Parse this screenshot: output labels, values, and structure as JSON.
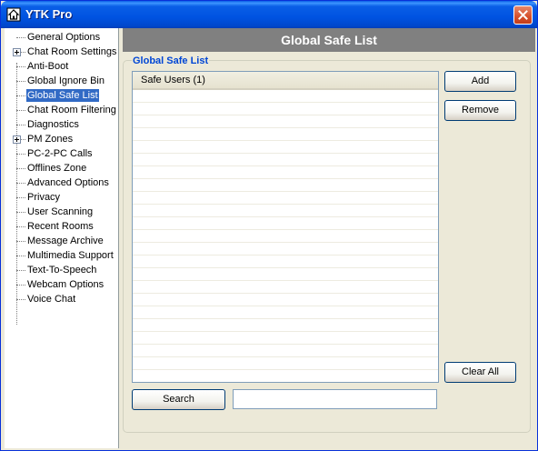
{
  "window": {
    "title": "YTK Pro",
    "app_icon": "home-icon",
    "close_icon": "close-icon",
    "title_color": "#0A5FE6"
  },
  "sidebar": {
    "items": [
      {
        "label": "General Options",
        "expandable": false
      },
      {
        "label": "Chat Room Settings",
        "expandable": true
      },
      {
        "label": "Anti-Boot",
        "expandable": false
      },
      {
        "label": "Global Ignore Bin",
        "expandable": false
      },
      {
        "label": "Global Safe List",
        "expandable": false,
        "selected": true
      },
      {
        "label": "Chat Room Filtering",
        "expandable": false
      },
      {
        "label": "Diagnostics",
        "expandable": false
      },
      {
        "label": "PM Zones",
        "expandable": true
      },
      {
        "label": "PC-2-PC Calls",
        "expandable": false
      },
      {
        "label": "Offlines Zone",
        "expandable": false
      },
      {
        "label": "Advanced Options",
        "expandable": false
      },
      {
        "label": "Privacy",
        "expandable": false
      },
      {
        "label": "User Scanning",
        "expandable": false
      },
      {
        "label": "Recent Rooms",
        "expandable": false
      },
      {
        "label": "Message Archive",
        "expandable": false
      },
      {
        "label": "Multimedia Support",
        "expandable": false
      },
      {
        "label": "Text-To-Speech",
        "expandable": false
      },
      {
        "label": "Webcam Options",
        "expandable": false
      },
      {
        "label": "Voice Chat",
        "expandable": false
      }
    ],
    "selected_color": "#316AC5"
  },
  "main": {
    "header": "Global Safe List",
    "group_title": "Global Safe List",
    "list_header": "Safe Users (1)",
    "buttons": {
      "add": "Add",
      "remove": "Remove",
      "clear_all": "Clear All",
      "search": "Search"
    },
    "search_value": "",
    "header_color": "#808080",
    "group_title_color": "#0046D5"
  }
}
